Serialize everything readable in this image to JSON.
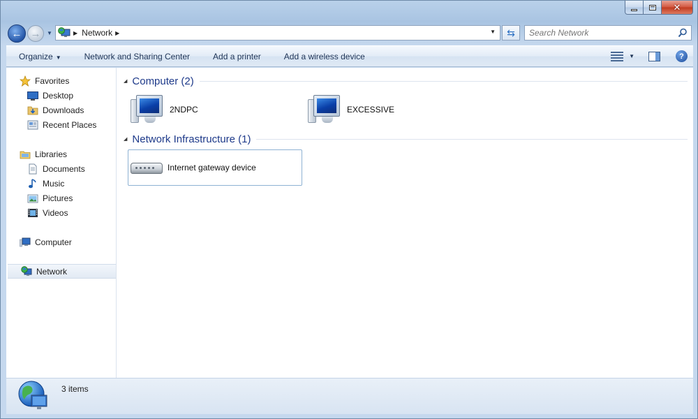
{
  "address": {
    "location": "Network"
  },
  "search": {
    "placeholder": "Search Network"
  },
  "toolbar": {
    "organize": "Organize",
    "network_sharing": "Network and Sharing Center",
    "add_printer": "Add a printer",
    "add_wireless": "Add a wireless device"
  },
  "sidebar": {
    "favorites": "Favorites",
    "desktop": "Desktop",
    "downloads": "Downloads",
    "recent_places": "Recent Places",
    "libraries": "Libraries",
    "documents": "Documents",
    "music": "Music",
    "pictures": "Pictures",
    "videos": "Videos",
    "computer": "Computer",
    "network": "Network"
  },
  "groups": {
    "computer": {
      "title": "Computer (2)",
      "items": [
        "2NDPC",
        "EXCESSIVE"
      ]
    },
    "infrastructure": {
      "title": "Network Infrastructure (1)",
      "items": [
        "Internet gateway device"
      ]
    }
  },
  "status": {
    "count": "3 items"
  },
  "colors": {
    "group_title": "#1e3a8a",
    "selection_border": "#8eb2d3",
    "accent": "#2456a8"
  },
  "icons": {
    "back": "back-arrow-icon",
    "forward": "forward-arrow-icon",
    "refresh": "refresh-icon",
    "search": "search-icon",
    "help": "help-icon"
  }
}
